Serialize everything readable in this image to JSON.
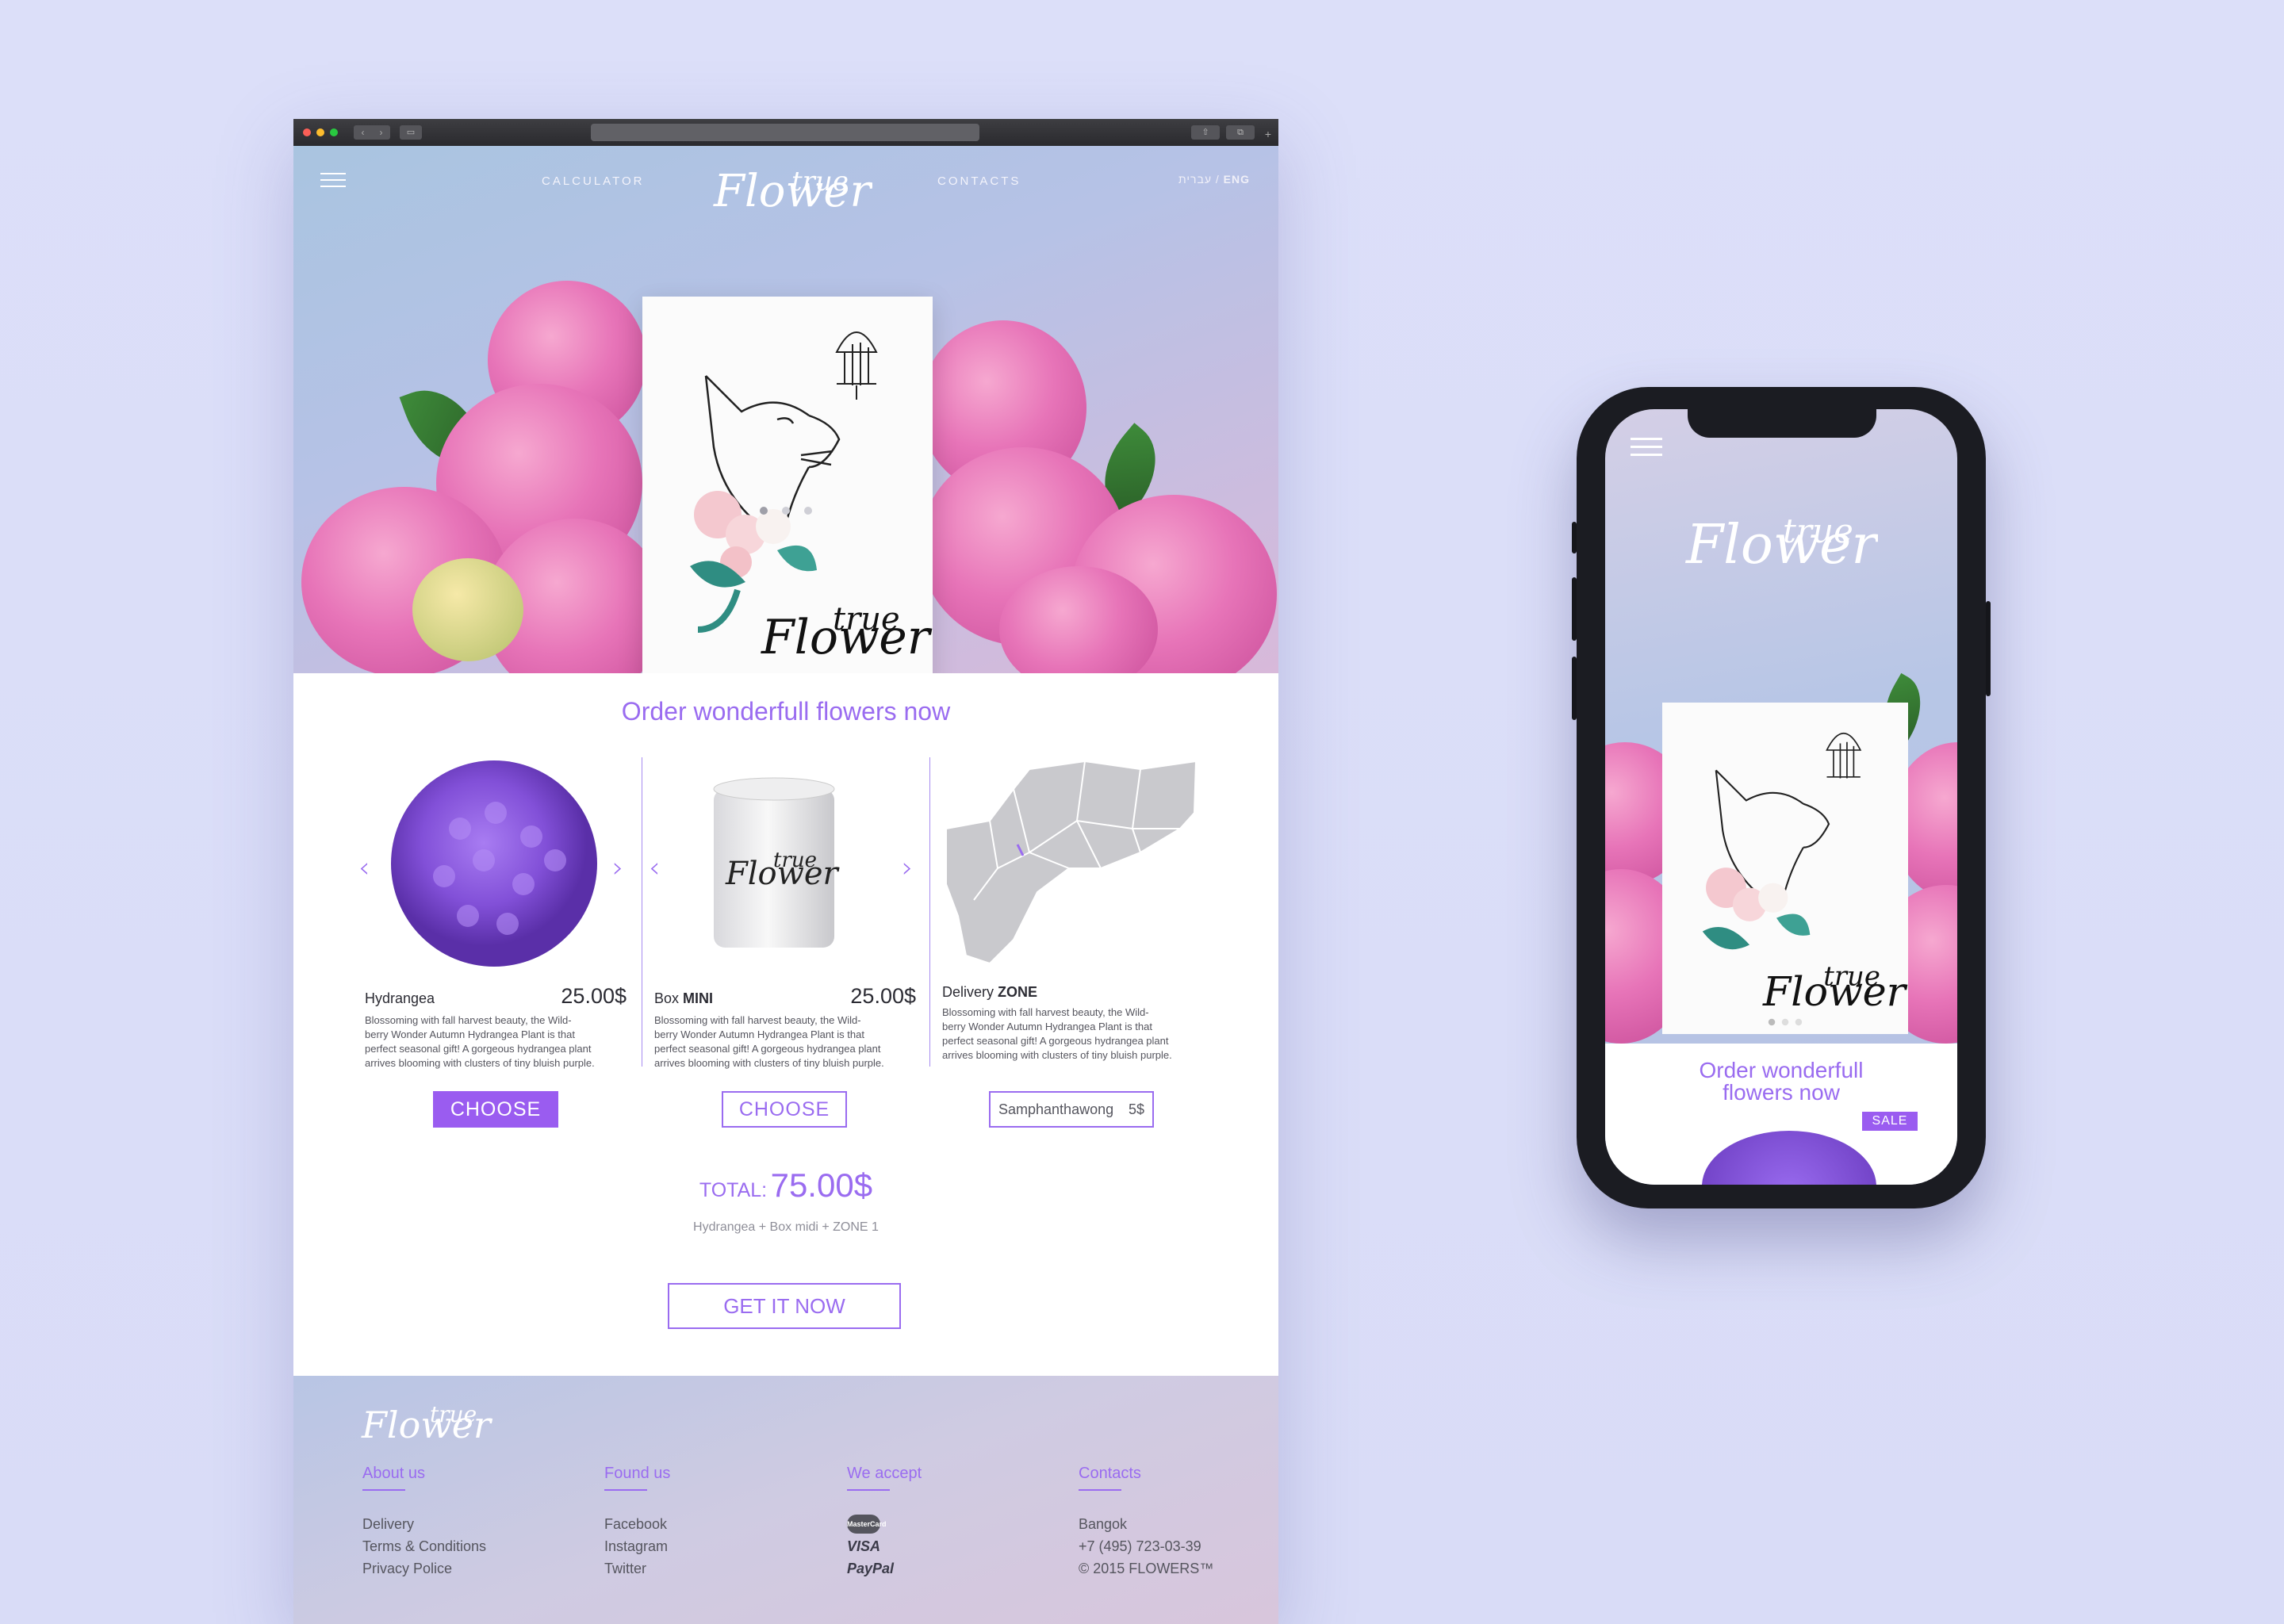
{
  "nav": {
    "calculator": "CALCULATOR",
    "contacts": "CONTACTS",
    "lang_he": "עברית /",
    "lang_en": "ENG"
  },
  "logo_text": "Flower true",
  "order": {
    "title": "Order wonderfull flowers now",
    "items": [
      {
        "name": "Hydrangea",
        "name_bold": "",
        "price": "25.00$",
        "desc": "Blossoming with fall harvest beauty, the Wild-berry Wonder Autumn Hydrangea Plant is that perfect seasonal gift! A gorgeous hydrangea plant arrives blooming with clusters of tiny bluish purple."
      },
      {
        "name": "Box",
        "name_bold": "MINI",
        "price": "25.00$",
        "desc": "Blossoming with fall harvest beauty, the Wild-berry Wonder Autumn Hydrangea Plant is that perfect seasonal gift! A gorgeous hydrangea plant arrives blooming with clusters of tiny bluish purple."
      },
      {
        "name": "Delivery",
        "name_bold": "ZONE",
        "price": "",
        "desc": "Blossoming with fall harvest beauty, the Wild-berry Wonder Autumn Hydrangea Plant is that perfect seasonal gift! A gorgeous hydrangea plant arrives blooming with clusters of tiny bluish purple."
      }
    ],
    "choose_label": "CHOOSE",
    "zone_select": {
      "value": "Samphanthawong",
      "price": "5$"
    },
    "total_label": "TOTAL:",
    "total_value": "75.00$",
    "total_sub": "Hydrangea + Box midi + ZONE 1",
    "get_label": "GET IT NOW"
  },
  "footer": {
    "about": {
      "title": "About us",
      "links": [
        "Delivery",
        "Terms & Conditions",
        "Privacy Police"
      ]
    },
    "found": {
      "title": "Found us",
      "links": [
        "Facebook",
        "Instagram",
        "Twitter"
      ]
    },
    "accept": {
      "title": "We accept",
      "methods": [
        "MasterCard",
        "VISA",
        "PayPal"
      ]
    },
    "contacts": {
      "title": "Contacts",
      "lines": [
        "Bangok",
        "+7 (495) 723-03-39",
        "© 2015 FLOWERS™"
      ]
    }
  },
  "phone": {
    "title_line1": "Order wonderfull",
    "title_line2": "flowers now",
    "sale": "SALE"
  },
  "colors": {
    "accent": "#9a5cf0",
    "text": "#2b2b33"
  }
}
